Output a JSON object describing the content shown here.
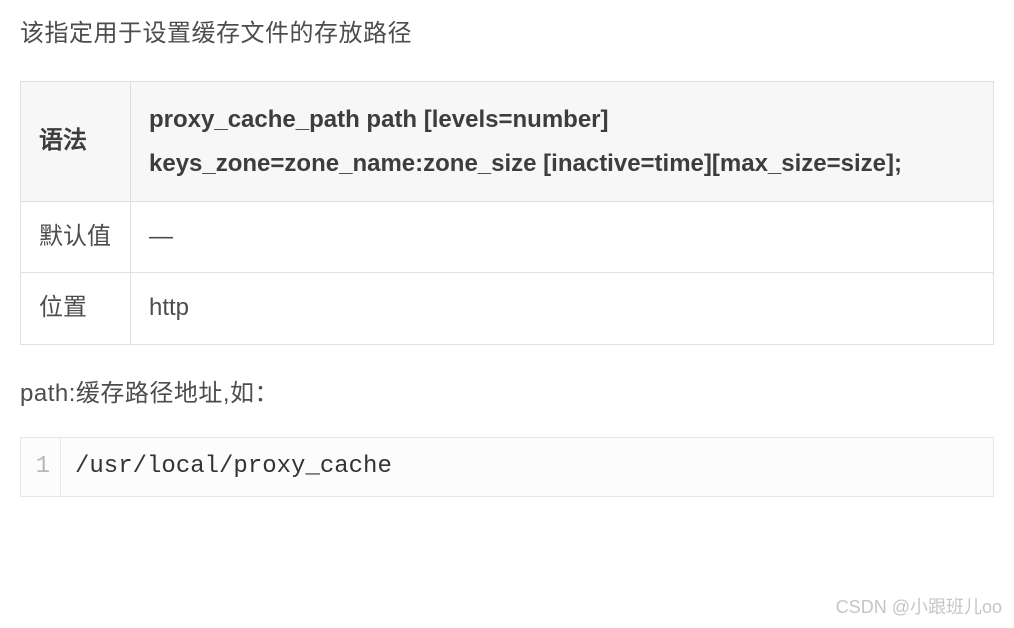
{
  "intro": "该指定用于设置缓存文件的存放路径",
  "table": {
    "rows": [
      {
        "label": "语法",
        "value": "proxy_cache_path path [levels=number] keys_zone=zone_name:zone_size [inactive=time][max_size=size];"
      },
      {
        "label": "默认值",
        "value": "—"
      },
      {
        "label": "位置",
        "value": "http"
      }
    ]
  },
  "note": "path:缓存路径地址,如：",
  "code": {
    "lineNumber": "1",
    "content": "/usr/local/proxy_cache"
  },
  "watermark": "CSDN @小跟班儿oo"
}
